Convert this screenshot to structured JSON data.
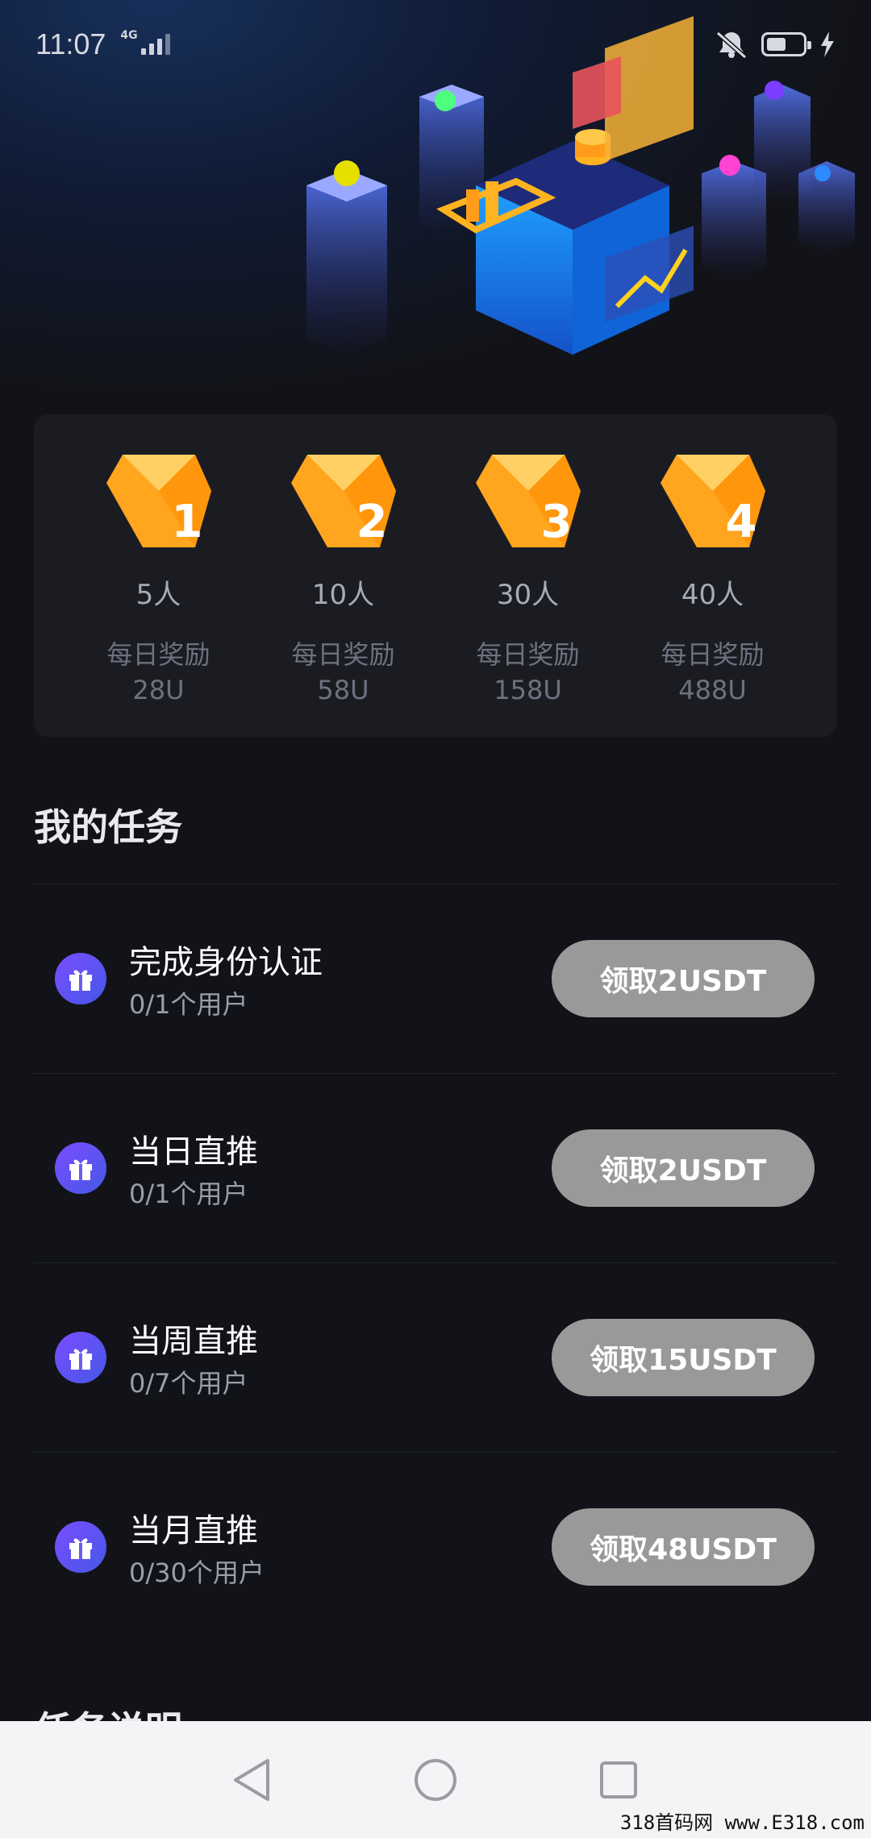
{
  "status_bar": {
    "time": "11:07",
    "network": "4G"
  },
  "levels": [
    {
      "number": "1",
      "people": "5人",
      "reward_label": "每日奖励",
      "reward_value": "28U"
    },
    {
      "number": "2",
      "people": "10人",
      "reward_label": "每日奖励",
      "reward_value": "58U"
    },
    {
      "number": "3",
      "people": "30人",
      "reward_label": "每日奖励",
      "reward_value": "158U"
    },
    {
      "number": "4",
      "people": "40人",
      "reward_label": "每日奖励",
      "reward_value": "488U"
    }
  ],
  "tasks_section": {
    "title": "我的任务",
    "items": [
      {
        "title": "完成身份认证",
        "progress": "0/1个用户",
        "button": "领取2USDT"
      },
      {
        "title": "当日直推",
        "progress": "0/1个用户",
        "button": "领取2USDT"
      },
      {
        "title": "当周直推",
        "progress": "0/7个用户",
        "button": "领取15USDT"
      },
      {
        "title": "当月直推",
        "progress": "0/30个用户",
        "button": "领取48USDT"
      }
    ]
  },
  "next_section_title": "任务说明",
  "watermark": "318首码网 www.E318.com",
  "colors": {
    "background": "#121318",
    "card": "#1b1c22",
    "badge_gold": "#ffa51e",
    "button_gray": "#999999",
    "gift_icon_gradient_start": "#7b4dff",
    "gift_icon_gradient_end": "#4458e6"
  }
}
